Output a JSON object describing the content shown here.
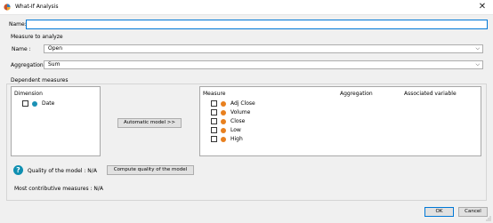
{
  "window": {
    "title": "What-If Analysis",
    "close_glyph": "✕"
  },
  "form": {
    "name_label": "Name:",
    "name_value": ""
  },
  "measure_to_analyze": {
    "header": "Measure to analyze",
    "name_label": "Name :",
    "name_value": "Open",
    "aggregation_label": "Aggregation",
    "aggregation_value": "Sum"
  },
  "dependent_measures": {
    "header": "Dependent measures",
    "dimension_header": "Dimension",
    "dimensions": [
      {
        "label": "Date",
        "checked": false,
        "icon": "dimension-icon"
      }
    ],
    "automatic_model_button": "Automatic model >>",
    "columns": {
      "measure": "Measure",
      "aggregation": "Aggregation",
      "associated_variable": "Associated variable"
    },
    "measures": [
      {
        "label": "Adj Close",
        "checked": false,
        "icon": "measure-icon"
      },
      {
        "label": "Volume",
        "checked": false,
        "icon": "measure-icon"
      },
      {
        "label": "Close",
        "checked": false,
        "icon": "measure-icon"
      },
      {
        "label": "Low",
        "checked": false,
        "icon": "measure-icon"
      },
      {
        "label": "High",
        "checked": false,
        "icon": "measure-icon"
      }
    ]
  },
  "quality": {
    "help_glyph": "?",
    "text": "Quality of the model : N/A",
    "compute_button": "Compute quality of the model",
    "contributive": "Most contributive measures : N/A"
  },
  "footer": {
    "ok": "OK",
    "cancel": "Cancel"
  },
  "colors": {
    "accent": "#0078d7",
    "measure_dot": "#e8801f",
    "dimension_dot": "#1b91b5",
    "help_icon": "#0f8fb1"
  }
}
